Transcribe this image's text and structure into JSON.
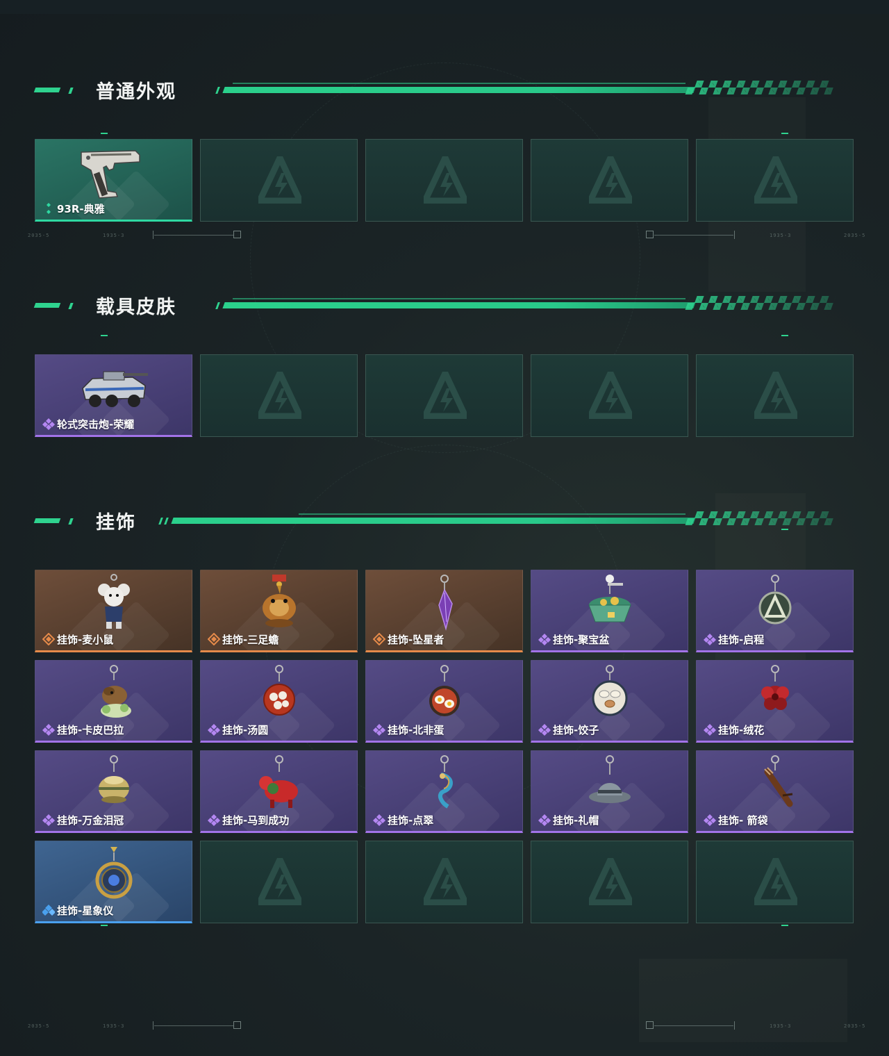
{
  "sections": {
    "normal": {
      "title": "普通外观",
      "items": [
        {
          "name": "93R-典雅",
          "rarity": "green",
          "icon": "pistol-icon"
        }
      ]
    },
    "vehicle": {
      "title": "载具皮肤",
      "items": [
        {
          "name": "轮式突击炮-荣耀",
          "rarity": "purple",
          "icon": "armored-vehicle-icon"
        }
      ]
    },
    "pendant": {
      "title": "挂饰",
      "items": [
        {
          "name": "挂饰-麦小鼠",
          "rarity": "orange",
          "icon": "mouse-pendant-icon"
        },
        {
          "name": "挂饰-三足蟾",
          "rarity": "orange",
          "icon": "toad-pendant-icon"
        },
        {
          "name": "挂饰-坠星者",
          "rarity": "orange",
          "icon": "crystal-pendant-icon"
        },
        {
          "name": "挂饰-聚宝盆",
          "rarity": "purple",
          "icon": "treasure-bowl-pendant-icon"
        },
        {
          "name": "挂饰-启程",
          "rarity": "purple",
          "icon": "emblem-pendant-icon"
        },
        {
          "name": "挂饰-卡皮巴拉",
          "rarity": "purple",
          "icon": "capybara-pendant-icon"
        },
        {
          "name": "挂饰-汤圆",
          "rarity": "purple",
          "icon": "dumpling-bowl-pendant-icon"
        },
        {
          "name": "挂饰-北非蛋",
          "rarity": "purple",
          "icon": "egg-pan-pendant-icon"
        },
        {
          "name": "挂饰-饺子",
          "rarity": "purple",
          "icon": "dumplings-pendant-icon"
        },
        {
          "name": "挂饰-绒花",
          "rarity": "purple",
          "icon": "flower-pendant-icon"
        },
        {
          "name": "挂饰-万金泪冠",
          "rarity": "purple",
          "icon": "crown-pendant-icon"
        },
        {
          "name": "挂饰-马到成功",
          "rarity": "purple",
          "icon": "horse-pendant-icon"
        },
        {
          "name": "挂饰-点翠",
          "rarity": "purple",
          "icon": "phoenix-pendant-icon"
        },
        {
          "name": "挂饰-礼帽",
          "rarity": "purple",
          "icon": "hat-pendant-icon"
        },
        {
          "name": "挂饰- 箭袋",
          "rarity": "purple",
          "icon": "quiver-pendant-icon"
        },
        {
          "name": "挂饰-星象仪",
          "rarity": "blue",
          "icon": "astrolabe-pendant-icon"
        }
      ]
    }
  },
  "colors": {
    "accent": "#2fd38f",
    "rarity_green": "#2fd9a2",
    "rarity_purple": "#a273e8",
    "rarity_orange": "#e58a4a",
    "rarity_blue": "#4aa0ee",
    "empty_slot": "#1e3a37"
  }
}
